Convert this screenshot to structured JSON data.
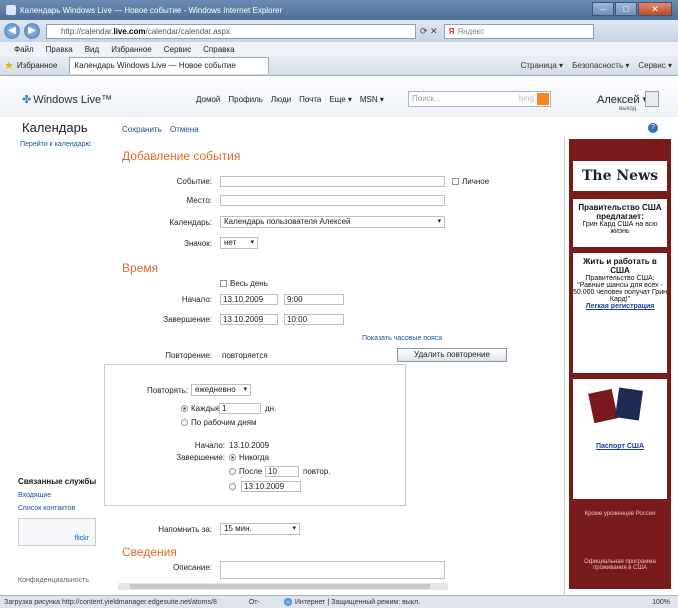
{
  "window": {
    "title": "Календарь Windows Live — Новое событие - Windows Internet Explorer"
  },
  "address": {
    "url_prefix": "http://calendar.",
    "url_bold": "live.com",
    "url_suffix": "/calendar/calendar.aspx",
    "search_engine": "Я",
    "search_placeholder": "Яндекс"
  },
  "menu": [
    "Файл",
    "Правка",
    "Вид",
    "Избранное",
    "Сервис",
    "Справка"
  ],
  "tabs": {
    "favorites": "Избранное",
    "active": "Календарь Windows Live — Новое событие",
    "commands": [
      "Страница ▾",
      "Безопасность ▾",
      "Сервис ▾"
    ]
  },
  "live": {
    "logo": "Windows Live™",
    "nav": [
      "Домой",
      "Профиль",
      "Люди",
      "Почта",
      "Еще ▾",
      "MSN ▾"
    ],
    "search_placeholder": "Поиск...",
    "search_brand": "bing",
    "user": "Алексей ▾",
    "signout": "выход"
  },
  "calendar": {
    "title": "Календарь",
    "save": "Сохранить",
    "cancel": "Отмена",
    "goto": "Перейти к календарю"
  },
  "form": {
    "heading": "Добавление события",
    "event_label": "Событие:",
    "event_value": "",
    "private_label": "Личное",
    "place_label": "Место:",
    "place_value": "",
    "calendars_label": "Календарь:",
    "calendars_value": "Календарь пользователя Алексей",
    "icon_label": "Значок:",
    "icon_value": "нет",
    "time_heading": "Время",
    "allday_label": "Весь день",
    "start_label": "Начало:",
    "start_date": "13.10.2009",
    "start_time": "9:00",
    "end_label": "Завершение:",
    "end_date": "13.10.2009",
    "end_time": "10:00",
    "timezones_link": "Показать часовые пояса",
    "repeat_label": "Повторение:",
    "repeat_value": "повторяется",
    "remove_repeat": "Удалить повторение",
    "repeat_every_label": "Повторять:",
    "repeat_every_value": "ежедневно",
    "every_label": "Каждые",
    "every_value": "1",
    "every_unit": "дн.",
    "workdays_label": "По рабочим дням",
    "start2_label": "Начало:",
    "start2_value": "13.10.2009",
    "end2_label": "Завершение:",
    "never_label": "Никогда",
    "after_label": "После",
    "after_value": "10",
    "after_unit": "повтор.",
    "until_value": "13.10.2009",
    "remind_label": "Напомнить за:",
    "remind_value": "15 мин.",
    "details_heading": "Сведения",
    "description_label": "Описание:"
  },
  "sidebar": {
    "title": "Связанные службы",
    "links": [
      "Входящие",
      "Список контактов"
    ],
    "flickr": "flickr",
    "privacy": "Конфиденциальность"
  },
  "ad": {
    "masthead": "The News",
    "box1_title": "Правительство США предлагает:",
    "box1_text": "Грин Кард США на всю жизнь",
    "box2_title": "Жить и работать в США",
    "box2_text": "Правительство США: \"Равные шансы для всех - 50.000 человек получат Грин Кард!\"",
    "box2_link": "Легкая регистрация",
    "passport_link": "Паспорт США",
    "except": "Кроме уроженцев России",
    "footer": "Официальная программа проживания в США"
  },
  "status": {
    "left": "Загрузка рисунка http://content.yieldmanager.edgesuite.net/atoms/8",
    "mid": "От-",
    "zone": "Интернет | Защищенный режим: выкл.",
    "zoom": "100%"
  }
}
